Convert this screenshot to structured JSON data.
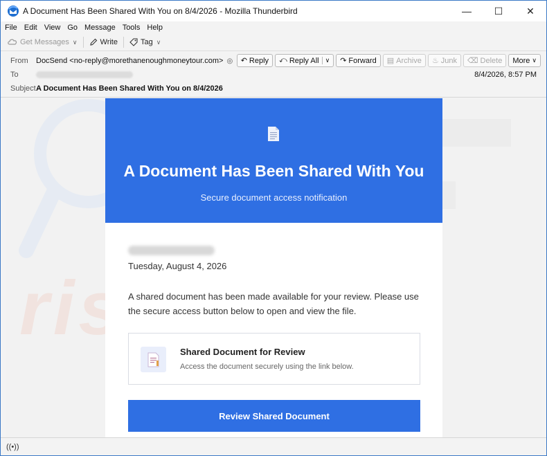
{
  "window": {
    "title": "A Document Has Been Shared With You on 8/4/2026 - Mozilla Thunderbird",
    "minimize": "—",
    "maximize": "☐",
    "close": "✕",
    "app_icon": "thunderbird-icon"
  },
  "menu": {
    "items": [
      "File",
      "Edit",
      "View",
      "Go",
      "Message",
      "Tools",
      "Help"
    ]
  },
  "toolbar": {
    "get_messages": "Get Messages",
    "write": "Write",
    "tag": "Tag"
  },
  "header": {
    "from_label": "From",
    "from_value": "DocSend <no-reply@morethanenoughmoneytour.com>",
    "to_label": "To",
    "subject_label": "Subject",
    "subject_value": "A Document Has Been Shared With You on 8/4/2026",
    "date": "8/4/2026, 8:57 PM",
    "actions": {
      "reply": "Reply",
      "reply_all": "Reply All",
      "forward": "Forward",
      "archive": "Archive",
      "junk": "Junk",
      "delete": "Delete",
      "more": "More"
    }
  },
  "email": {
    "banner_title": "A Document Has Been Shared With You",
    "banner_subtitle": "Secure document access notification",
    "date": "Tuesday, August 4, 2026",
    "paragraph": "A shared document has been made available for your review. Please use the secure access button below to open and view the file.",
    "card_title": "Shared Document for Review",
    "card_desc": "Access the document securely using the link below.",
    "button": "Review Shared Document"
  },
  "watermark": {
    "text": "risk.com"
  },
  "colors": {
    "accent": "#2f6fe3",
    "window_border": "#3a78c6"
  }
}
